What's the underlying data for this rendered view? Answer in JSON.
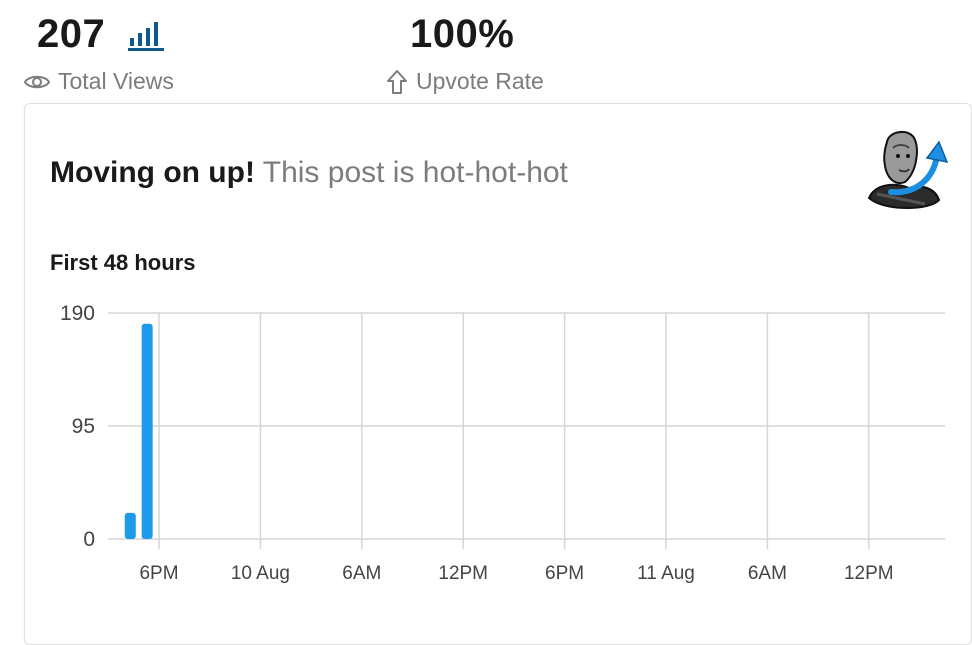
{
  "stats": {
    "views": {
      "value": "207",
      "label": "Total Views"
    },
    "upvote": {
      "value": "100%",
      "label": "Upvote Rate"
    }
  },
  "card": {
    "headline_strong": "Moving on up!",
    "headline_sub": "This post is hot-hot-hot",
    "subhead": "First 48 hours"
  },
  "icons": {
    "views": "eye-icon",
    "chart": "bar-chart-icon",
    "upvote": "upvote-arrow-icon",
    "mascot": "mascot-arrow-up-icon"
  },
  "colors": {
    "bar": "#1d9bea",
    "chart_link": "#0e5a8a",
    "grid": "#d6d6d6"
  },
  "chart_data": {
    "type": "bar",
    "title": "First 48 hours",
    "x_tick_labels": [
      "6PM",
      "10 Aug",
      "6AM",
      "12PM",
      "6PM",
      "11 Aug",
      "6AM",
      "12PM"
    ],
    "y_ticks": [
      0,
      95,
      190
    ],
    "ylim": [
      0,
      190
    ],
    "hour_bins": [
      {
        "label": "4PM",
        "value": 22
      },
      {
        "label": "5PM",
        "value": 181
      }
    ],
    "grid": true
  }
}
